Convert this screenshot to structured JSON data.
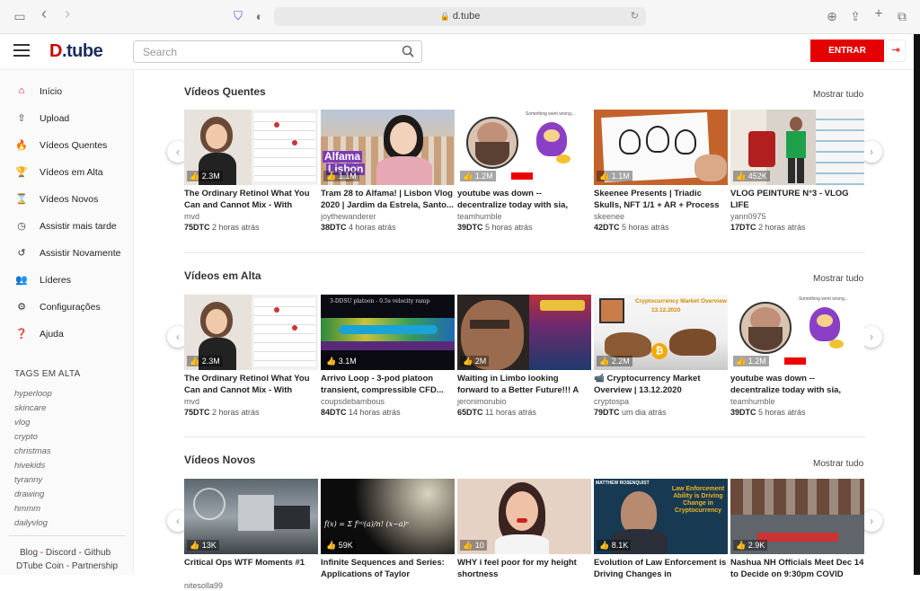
{
  "browser": {
    "url": "d.tube"
  },
  "header": {
    "logo": "D.tube",
    "logo_d": "D",
    "logo_rest": ".tube",
    "search_placeholder": "Search",
    "login_label": "ENTRAR"
  },
  "sidebar": {
    "items": [
      {
        "label": "Início",
        "icon": "home-icon"
      },
      {
        "label": "Upload",
        "icon": "upload-icon"
      },
      {
        "label": "Vídeos Quentes",
        "icon": "fire-icon"
      },
      {
        "label": "Vídeos em Alta",
        "icon": "trophy-icon"
      },
      {
        "label": "Vídeos Novos",
        "icon": "hourglass-icon"
      },
      {
        "label": "Assistir mais tarde",
        "icon": "clock-icon"
      },
      {
        "label": "Assistir Novamente",
        "icon": "history-icon"
      },
      {
        "label": "Líderes",
        "icon": "users-icon"
      },
      {
        "label": "Configurações",
        "icon": "gears-icon"
      },
      {
        "label": "Ajuda",
        "icon": "question-icon"
      }
    ],
    "tags_title": "TAGS EM ALTA",
    "tags": [
      "hyperloop",
      "skincare",
      "vlog",
      "crypto",
      "christmas",
      "hivekids",
      "tyranny",
      "drawing",
      "hmmm",
      "dailyvlog"
    ],
    "footer": {
      "blog": "Blog",
      "discord": "Discord",
      "github": "Github",
      "coin": "DTube Coin",
      "partnership": "Partnership"
    }
  },
  "accent_color": "#e50000",
  "sections": [
    {
      "title": "Vídeos Quentes",
      "show_all": "Mostrar tudo",
      "cards": [
        {
          "views": "2.3M",
          "title": "The Ordinary Retinol What You Can and Cannot Mix - With Real...",
          "author": "mvd",
          "dtc": "75DTC",
          "time": "2 horas atrás"
        },
        {
          "views": "1.1M",
          "title": "Tram 28 to Alfama! | Lisbon Vlog 2020 | Jardim da Estrela, Santo...",
          "author": "joythewanderer",
          "dtc": "38DTC",
          "time": "4 horas atrás"
        },
        {
          "views": "1.2M",
          "title": "youtube was down -- decentralize today with sia, odysee & dtube",
          "author": "teamhumble",
          "dtc": "39DTC",
          "time": "5 horas atrás"
        },
        {
          "views": "1.1M",
          "title": "Skeenee Presents | Triadic Skulls, NFT 1/1 + AR + Process",
          "author": "skeenee",
          "dtc": "42DTC",
          "time": "5 horas atrás"
        },
        {
          "views": "452K",
          "title": "VLOG PEINTURE N°3 - VLOG LIFE",
          "author": "yann0975",
          "dtc": "17DTC",
          "time": "2 horas atrás"
        }
      ]
    },
    {
      "title": "Vídeos em Alta",
      "show_all": "Mostrar tudo",
      "cards": [
        {
          "views": "2.3M",
          "title": "The Ordinary Retinol What You Can and Cannot Mix - With Real...",
          "author": "mvd",
          "dtc": "75DTC",
          "time": "2 horas atrás"
        },
        {
          "views": "3.1M",
          "title": "Arrivo Loop - 3-pod platoon transient, compressible CFD...",
          "author": "coupsdebambous",
          "dtc": "84DTC",
          "time": "14 horas atrás"
        },
        {
          "views": "2M",
          "title": "Waiting in Limbo looking forward to a Better Future!!! A Water...",
          "author": "jeronimorubio",
          "dtc": "65DTC",
          "time": "11 horas atrás"
        },
        {
          "views": "2.2M",
          "title": "📹 Cryptocurrency Market Overview | 13.12.2020",
          "author": "cryptospa",
          "dtc": "79DTC",
          "time": "um dia atrás"
        },
        {
          "views": "1.2M",
          "title": "youtube was down -- decentralize today with sia, odysee & dtube",
          "author": "teamhumble",
          "dtc": "39DTC",
          "time": "5 horas atrás"
        }
      ]
    },
    {
      "title": "Vídeos Novos",
      "show_all": "Mostrar tudo",
      "cards": [
        {
          "views": "13K",
          "title": "Critical Ops WTF Moments #1",
          "author": "nitesolla99",
          "dtc": "",
          "time": ""
        },
        {
          "views": "59K",
          "title": "Infinite Sequences and Series: Applications of Taylor",
          "author": "",
          "dtc": "",
          "time": ""
        },
        {
          "views": "10",
          "title": "WHY i feel poor for my height shortness",
          "author": "",
          "dtc": "",
          "time": ""
        },
        {
          "views": "8.1K",
          "title": "Evolution of Law Enforcement is Driving Changes in",
          "author": "",
          "dtc": "",
          "time": ""
        },
        {
          "views": "2.9K",
          "title": "Nashua NH Officials Meet Dec 14 to Decide on 9:30pm COVID",
          "author": "",
          "dtc": "",
          "time": ""
        }
      ]
    }
  ],
  "thumb_text": {
    "alfama": "Alfama",
    "lisbon": "Lisbon",
    "something_wrong": "Something went wrong...",
    "cfd": "3-DDSU platoon - 0.5s velocity ramp",
    "crypto_overview": "Cryptocurrency Market Overview",
    "crypto_date": "13.12.2020",
    "le_title": "Law Enforcement Ability is Driving Change in Cryptocurrency",
    "le_name": "MATTHEW ROSENQUIST"
  }
}
